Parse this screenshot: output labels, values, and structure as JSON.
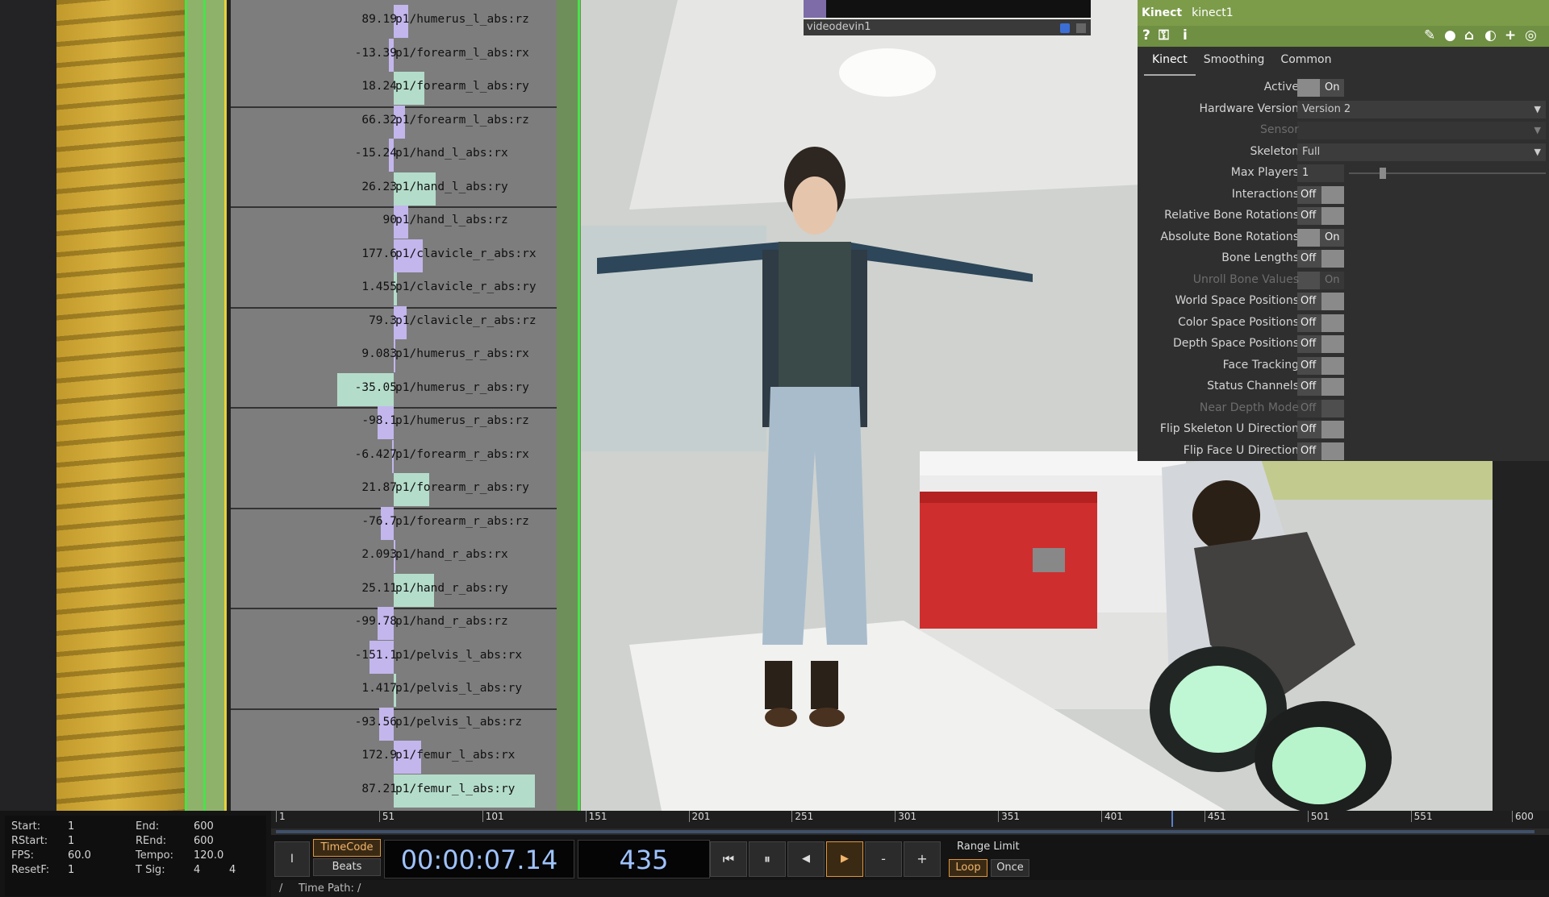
{
  "channels": [
    {
      "value": "89.19",
      "name": "p1/humerus_l_abs:rz",
      "bar": "purple",
      "barW": 18
    },
    {
      "value": "-13.39",
      "name": "p1/forearm_l_abs:rx",
      "bar": "purple",
      "barW": 6
    },
    {
      "value": "18.24",
      "name": "p1/forearm_l_abs:ry",
      "bar": "teal",
      "barW": 38
    },
    {
      "value": "66.32",
      "name": "p1/forearm_l_abs:rz",
      "bar": "purple",
      "barW": 14
    },
    {
      "value": "-15.24",
      "name": "p1/hand_l_abs:rx",
      "bar": "purple",
      "barW": 6
    },
    {
      "value": "26.23",
      "name": "p1/hand_l_abs:ry",
      "bar": "teal",
      "barW": 52
    },
    {
      "value": "90",
      "name": "p1/hand_l_abs:rz",
      "bar": "purple",
      "barW": 18
    },
    {
      "value": "177.6",
      "name": "p1/clavicle_r_abs:rx",
      "bar": "purple",
      "barW": 36
    },
    {
      "value": "1.455",
      "name": "p1/clavicle_r_abs:ry",
      "bar": "teal",
      "barW": 4
    },
    {
      "value": "79.3",
      "name": "p1/clavicle_r_abs:rz",
      "bar": "purple",
      "barW": 16
    },
    {
      "value": "9.083",
      "name": "p1/humerus_r_abs:rx",
      "bar": "purple",
      "barW": 2
    },
    {
      "value": "-35.05",
      "name": "p1/humerus_r_abs:ry",
      "bar": "teal",
      "barW": 70
    },
    {
      "value": "-98.1",
      "name": "p1/humerus_r_abs:rz",
      "bar": "purple",
      "barW": 20
    },
    {
      "value": "-6.427",
      "name": "p1/forearm_r_abs:rx",
      "bar": "purple",
      "barW": 2
    },
    {
      "value": "21.87",
      "name": "p1/forearm_r_abs:ry",
      "bar": "teal",
      "barW": 44
    },
    {
      "value": "-76.7",
      "name": "p1/forearm_r_abs:rz",
      "bar": "purple",
      "barW": 16
    },
    {
      "value": "2.093",
      "name": "p1/hand_r_abs:rx",
      "bar": "purple",
      "barW": 2
    },
    {
      "value": "25.11",
      "name": "p1/hand_r_abs:ry",
      "bar": "teal",
      "barW": 50
    },
    {
      "value": "-99.78",
      "name": "p1/hand_r_abs:rz",
      "bar": "purple",
      "barW": 20
    },
    {
      "value": "-151.1",
      "name": "p1/pelvis_l_abs:rx",
      "bar": "purple",
      "barW": 30
    },
    {
      "value": "1.417",
      "name": "p1/pelvis_l_abs:ry",
      "bar": "teal",
      "barW": 3
    },
    {
      "value": "-93.56",
      "name": "p1/pelvis_l_abs:rz",
      "bar": "purple",
      "barW": 18
    },
    {
      "value": "172.9",
      "name": "p1/femur_l_abs:rx",
      "bar": "purple",
      "barW": 34
    },
    {
      "value": "87.21",
      "name": "p1/femur_l_abs:ry",
      "bar": "teal",
      "barW": 175
    }
  ],
  "video": {
    "label": "videodevin1"
  },
  "kinect": {
    "type_label": "Kinect",
    "op_name": "kinect1",
    "tabs": [
      "Kinect",
      "Smoothing",
      "Common"
    ],
    "params": [
      {
        "label": "Active",
        "kind": "toggle",
        "state": "On"
      },
      {
        "label": "Hardware Version",
        "kind": "dropdown",
        "value": "Version 2"
      },
      {
        "label": "Sensor",
        "kind": "dropdown",
        "value": "",
        "dim": true
      },
      {
        "label": "Skeleton",
        "kind": "dropdown",
        "value": "Full"
      },
      {
        "label": "Max Players",
        "kind": "slider",
        "value": "1"
      },
      {
        "label": "Interactions",
        "kind": "toggle",
        "state": "Off"
      },
      {
        "label": "Relative Bone Rotations",
        "kind": "toggle",
        "state": "Off"
      },
      {
        "label": "Absolute Bone Rotations",
        "kind": "toggle",
        "state": "On"
      },
      {
        "label": "Bone Lengths",
        "kind": "toggle",
        "state": "Off"
      },
      {
        "label": "Unroll Bone Values",
        "kind": "toggle",
        "state": "On",
        "dim": true
      },
      {
        "label": "World Space Positions",
        "kind": "toggle",
        "state": "Off"
      },
      {
        "label": "Color Space Positions",
        "kind": "toggle",
        "state": "Off"
      },
      {
        "label": "Depth Space Positions",
        "kind": "toggle",
        "state": "Off"
      },
      {
        "label": "Face Tracking",
        "kind": "toggle",
        "state": "Off"
      },
      {
        "label": "Status Channels",
        "kind": "toggle",
        "state": "Off"
      },
      {
        "label": "Near Depth Mode",
        "kind": "toggle",
        "state": "Off",
        "dim": true
      },
      {
        "label": "Flip Skeleton U Direction",
        "kind": "toggle",
        "state": "Off"
      },
      {
        "label": "Flip Face U Direction",
        "kind": "toggle",
        "state": "Off"
      }
    ]
  },
  "timeline": {
    "ticks": [
      "1",
      "51",
      "101",
      "151",
      "201",
      "251",
      "301",
      "351",
      "401",
      "451",
      "501",
      "551",
      "600"
    ],
    "playhead_frame": 435,
    "range_start": 1,
    "range_end": 600,
    "start_label": "Start:",
    "start": "1",
    "end_label": "End:",
    "end": "600",
    "rstart_label": "RStart:",
    "rstart": "1",
    "rend_label": "REnd:",
    "rend": "600",
    "fps_label": "FPS:",
    "fps": "60.0",
    "tempo_label": "Tempo:",
    "tempo": "120.0",
    "resetf_label": "ResetF:",
    "resetf": "1",
    "tsig_label": "T Sig:",
    "tsig_a": "4",
    "tsig_b": "4",
    "timecode_btn": "TimeCode",
    "beats_btn": "Beats",
    "timecode": "00:00:07.14",
    "frame": "435",
    "range_limit_label": "Range Limit",
    "loop_btn": "Loop",
    "once_btn": "Once",
    "minus_label": "-",
    "plus_label": "+",
    "time_path_label": "Time Path: /",
    "slash": "/",
    "ibeam": "I"
  },
  "colors": {
    "purple_bar": "#c3b6ec",
    "teal_bar": "#b4dccb",
    "accent_orange": "#e0953a",
    "green_header": "#7c9c4a"
  }
}
